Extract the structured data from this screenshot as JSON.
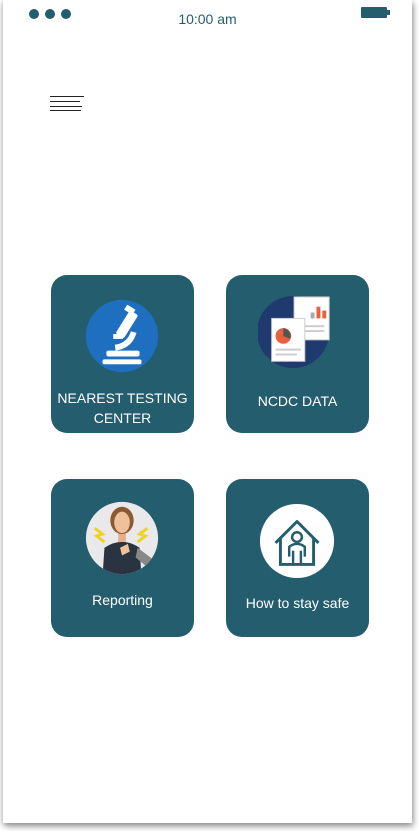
{
  "status_bar": {
    "time": "10:00 am"
  },
  "tiles": [
    {
      "label": "NEAREST TESTING CENTER",
      "icon": "microscope-icon"
    },
    {
      "label": "NCDC DATA",
      "icon": "data-report-icon"
    },
    {
      "label": "Reporting",
      "icon": "sick-person-icon"
    },
    {
      "label": "How to stay safe",
      "icon": "stay-home-icon"
    }
  ],
  "colors": {
    "primary": "#245e6e",
    "accent_blue": "#1e6fbf",
    "navy": "#1f3a6e"
  }
}
